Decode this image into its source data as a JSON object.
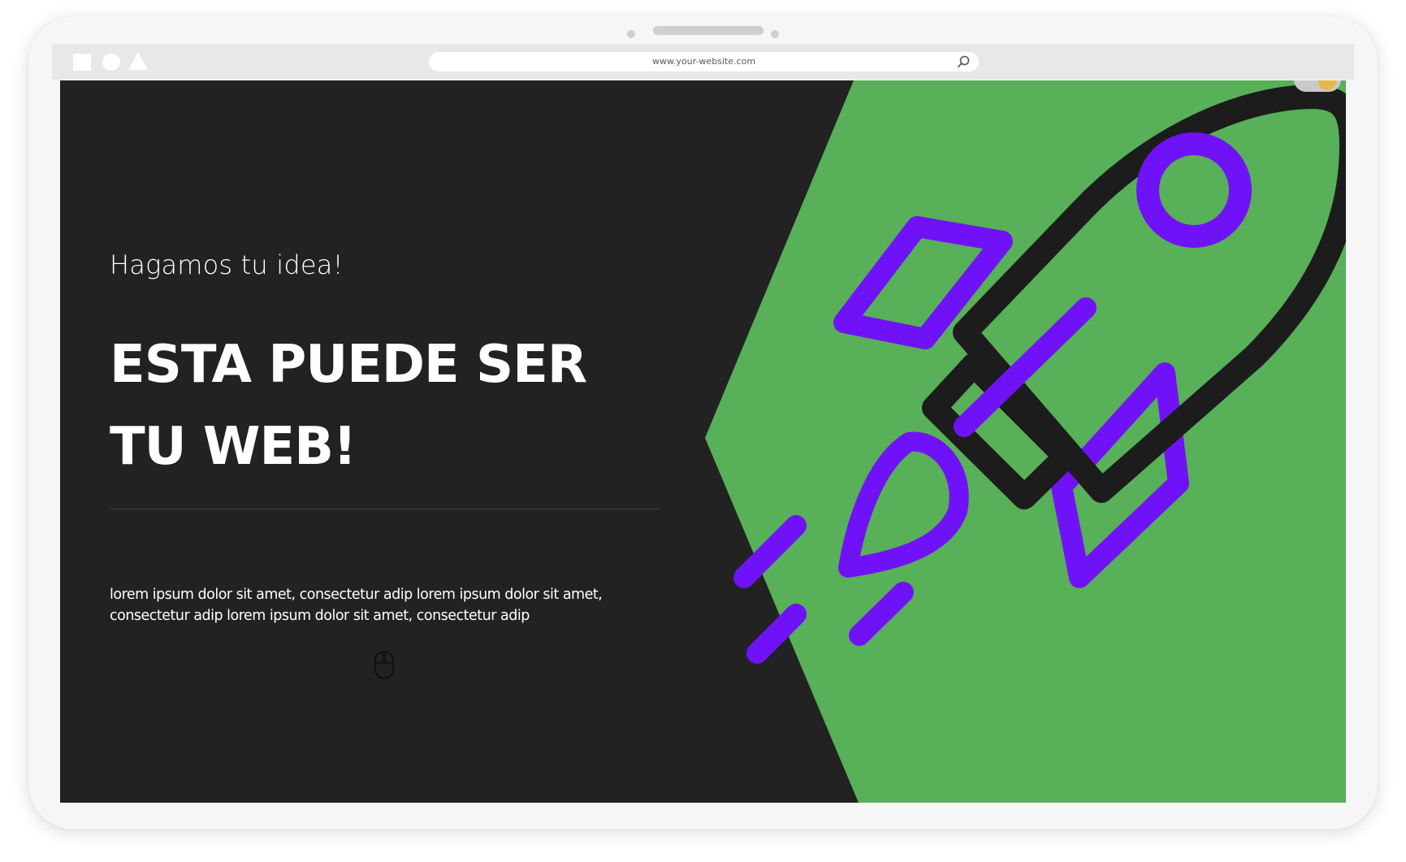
{
  "browser": {
    "url": "www.your-website.com"
  },
  "hero": {
    "subtitle": "Hagamos tu idea!",
    "headline": "ESTA PUEDE SER TU WEB!",
    "body": "lorem ipsum dolor sit amet, consectetur adip lorem ipsum dolor sit amet, consectetur adip lorem ipsum dolor sit amet, consectetur adip"
  },
  "icons": {
    "search": "search-icon",
    "scroll": "mouse-scroll-icon",
    "illustration": "rocket-illustration"
  },
  "colors": {
    "background": "#222222",
    "accent_green": "#58b058",
    "accent_purple": "#7012f8",
    "outline": "#1c1c1c",
    "text": "#ffffff"
  }
}
